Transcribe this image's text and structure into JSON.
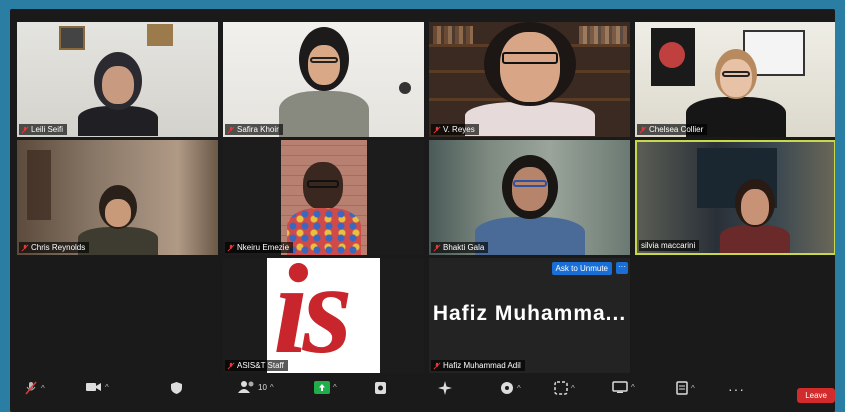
{
  "meeting": {
    "participants": [
      {
        "name": "Leili Seifi",
        "muted": true
      },
      {
        "name": "Safira Khoir",
        "muted": true
      },
      {
        "name": "V. Reyes",
        "muted": true
      },
      {
        "name": "Chelsea Collier",
        "muted": true
      },
      {
        "name": "Chris Reynolds",
        "muted": true
      },
      {
        "name": "Nkeiru Emezie",
        "muted": true
      },
      {
        "name": "Bhakti Gala",
        "muted": true
      },
      {
        "name": "silvia maccarini",
        "muted": false,
        "active_speaker": true
      },
      {
        "name": "ASIS&T Staff",
        "muted": true
      },
      {
        "name": "Hafiz Muhammad Adil",
        "muted": true,
        "display_name_tile": "Hafiz  Muhamma...",
        "ask_to_unmute": "Ask to Unmute",
        "more": "···"
      }
    ],
    "logo_text": "is"
  },
  "toolbar": {
    "participants_count": "10",
    "leave_label": "Leave",
    "items": [
      "mic-off-icon",
      "video-icon",
      "security-icon",
      "participants-icon",
      "share-icon",
      "record-icon",
      "ai-icon",
      "apps-icon",
      "whiteboard-icon",
      "view-icon",
      "notes-icon",
      "more-icon"
    ]
  },
  "colors": {
    "accent": "#1a6fd6",
    "leave": "#d12b2b",
    "speaker_border": "#c8d84a",
    "background": "#2a7ea3"
  }
}
